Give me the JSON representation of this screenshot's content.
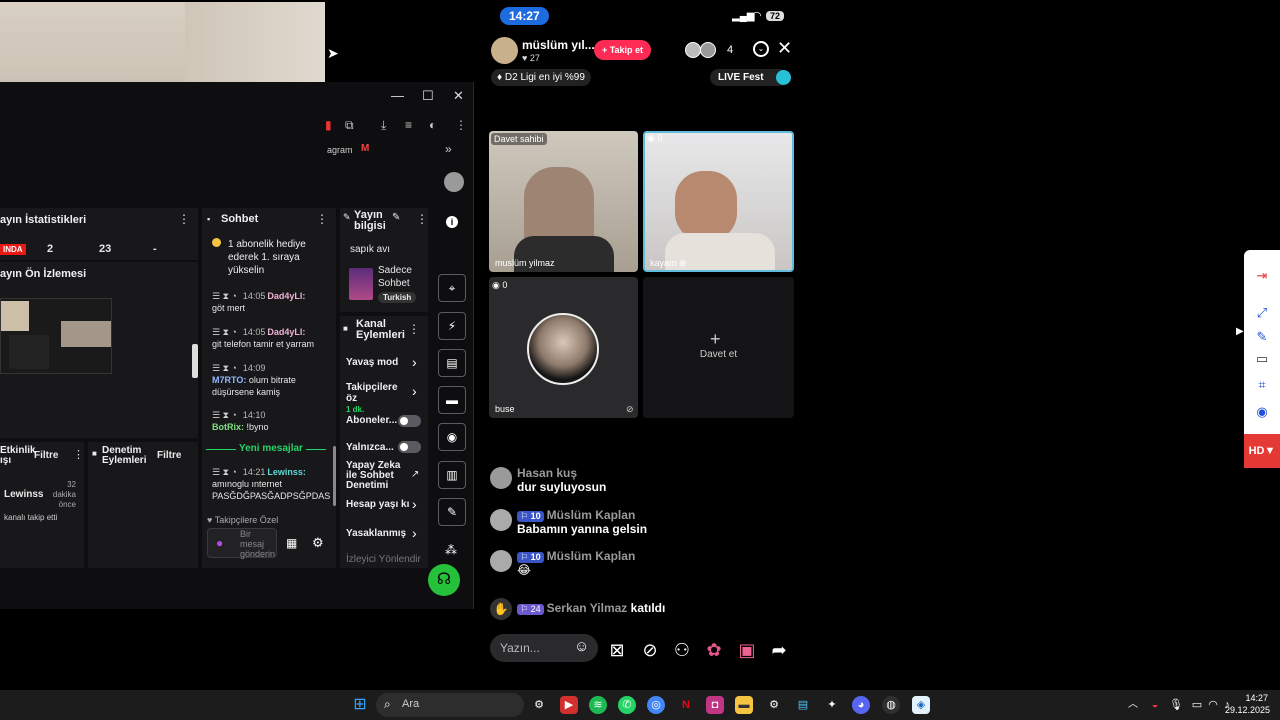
{
  "dashboard": {
    "bookmarks": [
      "agram"
    ],
    "stats": {
      "title": "ayın İstatistikleri",
      "live_badge": "INDA",
      "v1": "2",
      "v2": "23",
      "v3": "-"
    },
    "preview_title": "ayın Ön İzlemesi",
    "chat": {
      "title": "Sohbet",
      "pinned": "1 abonelik hediye ederek 1. sıraya yükselin",
      "messages": [
        {
          "time": "14:05",
          "user": "Dad4yLl:",
          "text": "göt mert",
          "color": "pink"
        },
        {
          "time": "14:05",
          "user": "Dad4yLl:",
          "text": "git telefon tamir et yarram",
          "color": "pink"
        },
        {
          "time": "14:09",
          "user": "M7RTO:",
          "text": "olum bitrate düşürsene kamiş",
          "color": "blue"
        },
        {
          "time": "14:10",
          "user": "BotRix:",
          "text": "!byno",
          "color": "green"
        },
        {
          "time": "14:21",
          "user": "Lewinss:",
          "text": "amınoglu ınternet PASĞDĞPASĞADPSĞPDAS",
          "color": "teal"
        }
      ],
      "new_messages": "Yeni mesajlar",
      "followers_only": "Takipçilere Özel",
      "input_placeholder": "Bir mesaj gönderin"
    },
    "stream_info": {
      "title": "Yayın bilgisi",
      "stream_name": "sapık avı",
      "category": "Sadece Sohbet",
      "tag": "Turkish"
    },
    "channel_actions": {
      "title": "Kanal Eylemleri",
      "items": [
        {
          "label": "Yavaş mod",
          "kind": "chevron"
        },
        {
          "label": "Takipçilere öz",
          "sub": "1 dk.",
          "kind": "chevron"
        },
        {
          "label": "Aboneler...",
          "kind": "toggle"
        },
        {
          "label": "Yalnızca...",
          "kind": "toggle"
        },
        {
          "label": "Yapay Zeka ile Sohbet Denetimi",
          "kind": "external"
        },
        {
          "label": "Hesap yaşı kı",
          "kind": "chevron"
        },
        {
          "label": "Yasaklanmış",
          "kind": "chevron"
        }
      ],
      "footer": "İzleyici Yönlendir"
    },
    "activity": {
      "title": "Etkinlik",
      "title2": "ışı",
      "filter": "Filtre",
      "user": "Lewinss",
      "ago": "32 dakika önce",
      "event": "kanalı takip etti"
    },
    "moderation": {
      "title": "Denetim Eylemleri",
      "filter": "Filtre"
    }
  },
  "phone": {
    "status_time": "14:27",
    "battery": "72",
    "host": {
      "name": "müslüm yıl...",
      "likes": "27",
      "follow": "Takip et"
    },
    "viewers": "4",
    "badge": "D2 Ligi en iyi %99",
    "live_fest": "LIVE Fest",
    "tiles": [
      {
        "tag": "Davet sahibi",
        "name": "muslüm yilmaz"
      },
      {
        "tag": "0",
        "name": "kayam"
      },
      {
        "tag": "0",
        "name": "buse"
      },
      {
        "invite": "Davet et"
      }
    ],
    "comments": [
      {
        "user": "Hasan kuş",
        "text": "dur suyluyosun"
      },
      {
        "level": "10",
        "user": "Müslüm Kaplan",
        "text": "Babamın yanına gelsin"
      },
      {
        "level": "10",
        "user": "Müslüm Kaplan",
        "text": "😂"
      },
      {
        "level": "24",
        "user": "Serkan Yilmaz",
        "text": "katıldı"
      }
    ],
    "input_placeholder": "Yazın..."
  },
  "edge_tools": {
    "hd_label": "HD"
  },
  "taskbar": {
    "search": "Ara",
    "time": "14:27",
    "date": "29.12.2025"
  }
}
